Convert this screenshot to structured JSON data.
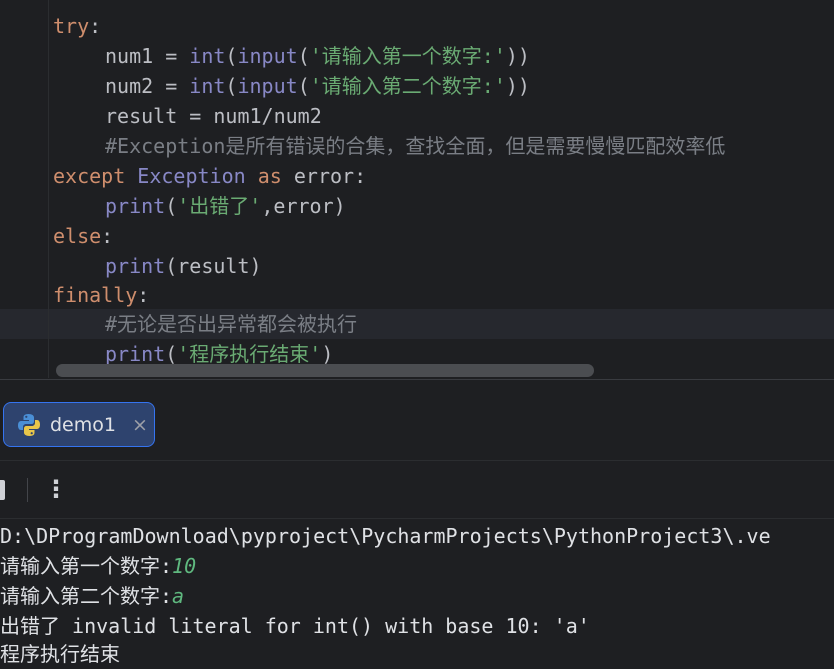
{
  "editor": {
    "lines": {
      "l0": {
        "kw": "try",
        "colon": ":"
      },
      "l1": {
        "lhs": "num1 = ",
        "fn1": "int",
        "p1": "(",
        "fn2": "input",
        "p2": "(",
        "str": "'请输入第一个数字:'",
        "close": "))"
      },
      "l2": {
        "lhs": "num2 = ",
        "fn1": "int",
        "p1": "(",
        "fn2": "input",
        "p2": "(",
        "str": "'请输入第二个数字:'",
        "close": "))"
      },
      "l3": {
        "text": "result = num1/num2"
      },
      "l4": {
        "comment": "#Exception是所有错误的合集，查找全面，但是需要慢慢匹配效率低"
      },
      "l5": {
        "kw": "except",
        "cls": "Exception",
        "as": "as",
        "name": "error",
        "colon": ":"
      },
      "l6": {
        "fn": "print",
        "open": "(",
        "str": "'出错了'",
        "rest": ",error)"
      },
      "l7": {
        "kw": "else",
        "colon": ":"
      },
      "l8": {
        "fn": "print",
        "rest": "(result)"
      },
      "l9": {
        "kw": "finally",
        "colon": ":"
      },
      "l10": {
        "comment": "#无论是否出异常都会被执行"
      },
      "l11": {
        "fn": "print",
        "open": "(",
        "str": "'程序执行结束'",
        "close": ")"
      }
    }
  },
  "run_panel": {
    "tab_label": "demo1",
    "tab_icon": "python-icon",
    "close_glyph": "×",
    "more_glyph": "⋮"
  },
  "console": {
    "path": "D:\\DProgramDownload\\pyproject\\PycharmProjects\\PythonProject3\\.ve",
    "prompt1": "请输入第一个数字:",
    "input1": "10",
    "prompt2": "请输入第二个数字:",
    "input2": "a",
    "error": "出错了 invalid literal for int() with base 10: 'a'",
    "final": "程序执行结束"
  },
  "colors": {
    "background": "#1e1f22",
    "keyword": "#cf8e6d",
    "builtin": "#8888c6",
    "string": "#6aab73",
    "comment": "#7a7e85",
    "text": "#bcbec4",
    "tab_accent": "#3574f0",
    "console_input": "#5fb87f"
  }
}
